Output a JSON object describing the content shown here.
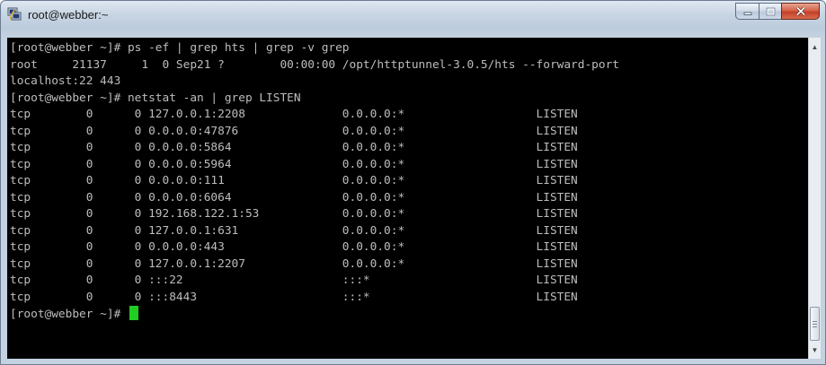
{
  "window": {
    "title": "root@webber:~",
    "icons": {
      "app": "putty-icon",
      "minimize": "minimize-icon",
      "maximize": "maximize-icon",
      "close": "close-icon"
    }
  },
  "terminal": {
    "lines": [
      "[root@webber ~]# ps -ef | grep hts | grep -v grep",
      "root     21137     1  0 Sep21 ?        00:00:00 /opt/httptunnel-3.0.5/hts --forward-port",
      "localhost:22 443",
      "[root@webber ~]# netstat -an | grep LISTEN",
      "tcp        0      0 127.0.0.1:2208              0.0.0.0:*                   LISTEN",
      "tcp        0      0 0.0.0.0:47876               0.0.0.0:*                   LISTEN",
      "tcp        0      0 0.0.0.0:5864                0.0.0.0:*                   LISTEN",
      "tcp        0      0 0.0.0.0:5964                0.0.0.0:*                   LISTEN",
      "tcp        0      0 0.0.0.0:111                 0.0.0.0:*                   LISTEN",
      "tcp        0      0 0.0.0.0:6064                0.0.0.0:*                   LISTEN",
      "tcp        0      0 192.168.122.1:53            0.0.0.0:*                   LISTEN",
      "tcp        0      0 127.0.0.1:631               0.0.0.0:*                   LISTEN",
      "tcp        0      0 0.0.0.0:443                 0.0.0.0:*                   LISTEN",
      "tcp        0      0 127.0.0.1:2207              0.0.0.0:*                   LISTEN",
      "tcp        0      0 :::22                       :::*                        LISTEN",
      "tcp        0      0 :::8443                     :::*                        LISTEN"
    ],
    "prompt": "[root@webber ~]# ",
    "colors": {
      "background": "#000000",
      "foreground": "#bdbdbd",
      "cursor": "#22cc22"
    }
  },
  "scrollbar": {
    "up_arrow": "scroll-up-icon",
    "down_arrow": "scroll-down-icon"
  }
}
